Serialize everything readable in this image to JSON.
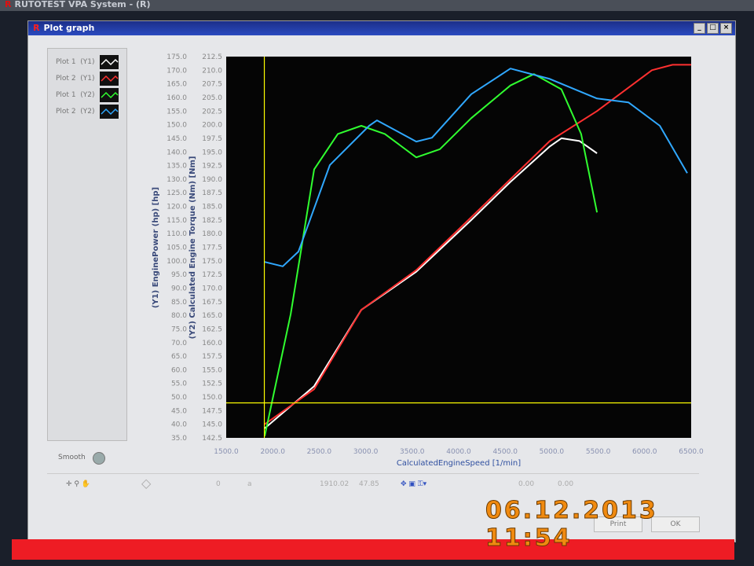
{
  "app_title": "RUTOTEST VPA System - (R)",
  "window": {
    "title": "Plot graph",
    "logo": "R"
  },
  "legend": [
    {
      "label": "Plot 1",
      "axis": "(Y1)",
      "color": "#ffffff"
    },
    {
      "label": "Plot 2",
      "axis": "(Y1)",
      "color": "#ff3030"
    },
    {
      "label": "Plot 1",
      "axis": "(Y2)",
      "color": "#30ff30"
    },
    {
      "label": "Plot 2",
      "axis": "(Y2)",
      "color": "#30a8ff"
    }
  ],
  "smooth_label": "Smooth",
  "toolbar": {
    "field0": "0",
    "field_a": "a",
    "cursor_x": "1910.02",
    "cursor_y": "47.85",
    "f1": "0.00",
    "f2": "0.00"
  },
  "buttons": {
    "print": "Print",
    "ok": "OK"
  },
  "timestamp": "06.12.2013  11:54",
  "chart_data": {
    "type": "line",
    "xlabel": "CalculatedEngineSpeed [1/min]",
    "y1label": "(Y1)   EnginePower (hp) [hp]",
    "y2label": "(Y2)   Calculated Engine Torque (Nm) [Nm]",
    "xlim": [
      1500,
      6500
    ],
    "y1lim": [
      35,
      175
    ],
    "y2lim": [
      142.5,
      212.5
    ],
    "xticks": [
      "1500.0",
      "2000.0",
      "2500.0",
      "3000.0",
      "3500.0",
      "4000.0",
      "4500.0",
      "5000.0",
      "5500.0",
      "6000.0",
      "6500.0"
    ],
    "y1ticks": [
      "175.0",
      "170.0",
      "165.0",
      "160.0",
      "155.0",
      "150.0",
      "145.0",
      "140.0",
      "135.0",
      "130.0",
      "125.0",
      "120.0",
      "115.0",
      "110.0",
      "105.0",
      "100.0",
      "95.0",
      "90.0",
      "85.0",
      "80.0",
      "75.0",
      "70.0",
      "65.0",
      "60.0",
      "55.0",
      "50.0",
      "45.0",
      "40.0",
      "35.0"
    ],
    "y2ticks": [
      "212.5",
      "210.0",
      "207.5",
      "205.0",
      "202.5",
      "200.0",
      "197.5",
      "195.0",
      "192.5",
      "190.0",
      "187.5",
      "185.0",
      "182.5",
      "180.0",
      "177.5",
      "175.0",
      "172.5",
      "170.0",
      "167.5",
      "165.0",
      "162.5",
      "160.0",
      "157.5",
      "155.0",
      "152.5",
      "150.0",
      "147.5",
      "145.0",
      "142.5"
    ],
    "cursor": {
      "x": 1910.02,
      "y": 47.85,
      "color": "#ffff00"
    },
    "series": [
      {
        "name": "Plot 1 (Y1)",
        "axis": "y1",
        "color": "#ffffff",
        "x": [
          1914,
          2446,
          2953,
          3544,
          4135,
          4557,
          4980,
          5105,
          5300,
          5487
        ],
        "y": [
          38.5,
          54,
          82,
          96,
          115,
          129,
          142,
          145,
          144,
          139.5
        ]
      },
      {
        "name": "Plot 2 (Y1)",
        "axis": "y1",
        "color": "#ff3030",
        "x": [
          1914,
          2446,
          2953,
          3544,
          4135,
          4980,
          5487,
          6078,
          6300,
          6500
        ],
        "y": [
          40,
          52.9,
          82,
          96.6,
          116,
          144,
          155,
          170,
          172,
          172
        ]
      },
      {
        "name": "Plot 1 (Y2)",
        "axis": "y2",
        "color": "#30ff30",
        "x": [
          1914,
          2193,
          2446,
          2700,
          2953,
          3206,
          3544,
          3797,
          4135,
          4557,
          4810,
          5105,
          5317,
          5487
        ],
        "y": [
          142.8,
          165.2,
          191.8,
          198.3,
          199.8,
          198.3,
          194,
          195.5,
          201.2,
          207.2,
          209.3,
          206.5,
          198.3,
          183.9
        ]
      },
      {
        "name": "Plot 2 (Y2)",
        "axis": "y2",
        "color": "#30a8ff",
        "x": [
          1914,
          2108,
          2277,
          2615,
          3037,
          3122,
          3544,
          3713,
          4135,
          4557,
          4980,
          5487,
          5825,
          6163,
          6458
        ],
        "y": [
          174.8,
          174,
          176.7,
          192.6,
          199.8,
          200.8,
          196.9,
          197.6,
          205.6,
          210.3,
          208.4,
          204.8,
          204.1,
          199.8,
          191.1
        ]
      }
    ]
  }
}
